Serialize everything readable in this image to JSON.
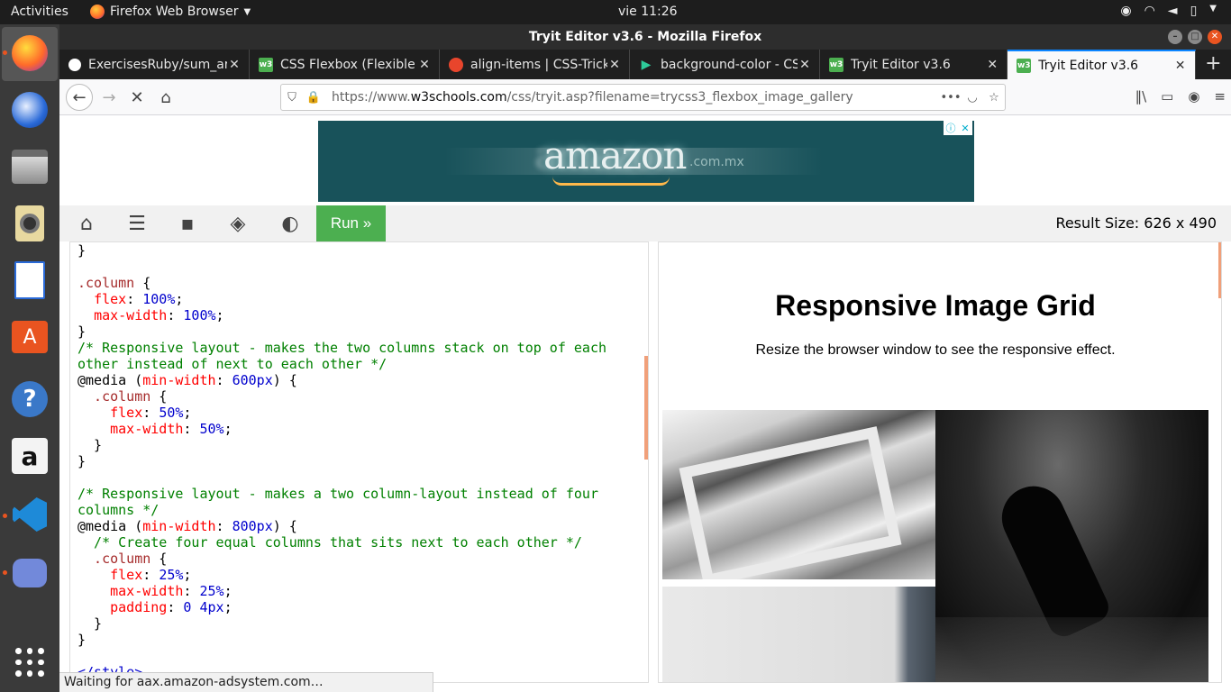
{
  "topbar": {
    "activities": "Activities",
    "app_menu": "Firefox Web Browser",
    "clock": "vie 11:26"
  },
  "window": {
    "title": "Tryit Editor v3.6 - Mozilla Firefox"
  },
  "tabs": [
    {
      "label": "ExercisesRuby/sum_ar",
      "icon": "github-icon"
    },
    {
      "label": "CSS Flexbox (Flexible B",
      "icon": "w3schools-icon"
    },
    {
      "label": "align-items | CSS-Tricks",
      "icon": "css-tricks-icon"
    },
    {
      "label": "background-color - CSS",
      "icon": "mdn-icon"
    },
    {
      "label": "Tryit Editor v3.6",
      "icon": "w3schools-icon"
    },
    {
      "label": "Tryit Editor v3.6",
      "icon": "w3schools-icon"
    }
  ],
  "navbar": {
    "url_prefix": "https://www.",
    "url_domain": "w3schools.com",
    "url_path": "/css/tryit.asp?filename=trycss3_flexbox_image_gallery"
  },
  "ad": {
    "logo": "amazon",
    "domain_suffix": ".com.mx",
    "info": "ⓘ",
    "close": "✕"
  },
  "editor_toolbar": {
    "run_label": "Run »",
    "result_size": "Result Size: 626 x 490"
  },
  "code_lines": [
    [
      {
        "t": "}",
        "c": ""
      }
    ],
    [
      {
        "t": "",
        "c": ""
      }
    ],
    [
      {
        "t": ".column",
        "c": "c-sel"
      },
      {
        "t": " {",
        "c": ""
      }
    ],
    [
      {
        "t": "  ",
        "c": ""
      },
      {
        "t": "flex",
        "c": "c-prop"
      },
      {
        "t": ": ",
        "c": ""
      },
      {
        "t": "100%",
        "c": "c-val"
      },
      {
        "t": ";",
        "c": ""
      }
    ],
    [
      {
        "t": "  ",
        "c": ""
      },
      {
        "t": "max-width",
        "c": "c-prop"
      },
      {
        "t": ": ",
        "c": ""
      },
      {
        "t": "100%",
        "c": "c-val"
      },
      {
        "t": ";",
        "c": ""
      }
    ],
    [
      {
        "t": "}",
        "c": ""
      }
    ],
    [
      {
        "t": "/* Responsive layout - makes the two columns stack on top of each",
        "c": "c-com"
      }
    ],
    [
      {
        "t": "other instead of next to each other */",
        "c": "c-com"
      }
    ],
    [
      {
        "t": "@media (",
        "c": "c-at"
      },
      {
        "t": "min-width",
        "c": "c-prop"
      },
      {
        "t": ": ",
        "c": ""
      },
      {
        "t": "600px",
        "c": "c-val"
      },
      {
        "t": ") {",
        "c": ""
      }
    ],
    [
      {
        "t": "  .column",
        "c": "c-sel"
      },
      {
        "t": " {",
        "c": ""
      }
    ],
    [
      {
        "t": "    ",
        "c": ""
      },
      {
        "t": "flex",
        "c": "c-prop"
      },
      {
        "t": ": ",
        "c": ""
      },
      {
        "t": "50%",
        "c": "c-val"
      },
      {
        "t": ";",
        "c": ""
      }
    ],
    [
      {
        "t": "    ",
        "c": ""
      },
      {
        "t": "max-width",
        "c": "c-prop"
      },
      {
        "t": ": ",
        "c": ""
      },
      {
        "t": "50%",
        "c": "c-val"
      },
      {
        "t": ";",
        "c": ""
      }
    ],
    [
      {
        "t": "  }",
        "c": ""
      }
    ],
    [
      {
        "t": "}",
        "c": ""
      }
    ],
    [
      {
        "t": "",
        "c": ""
      }
    ],
    [
      {
        "t": "/* Responsive layout - makes a two column-layout instead of four",
        "c": "c-com"
      }
    ],
    [
      {
        "t": "columns */",
        "c": "c-com"
      }
    ],
    [
      {
        "t": "@media (",
        "c": "c-at"
      },
      {
        "t": "min-width",
        "c": "c-prop"
      },
      {
        "t": ": ",
        "c": ""
      },
      {
        "t": "800px",
        "c": "c-val"
      },
      {
        "t": ") {",
        "c": ""
      }
    ],
    [
      {
        "t": "  /* Create four equal columns that sits next to each other */",
        "c": "c-com"
      }
    ],
    [
      {
        "t": "  .column",
        "c": "c-sel"
      },
      {
        "t": " {",
        "c": ""
      }
    ],
    [
      {
        "t": "    ",
        "c": ""
      },
      {
        "t": "flex",
        "c": "c-prop"
      },
      {
        "t": ": ",
        "c": ""
      },
      {
        "t": "25%",
        "c": "c-val"
      },
      {
        "t": ";",
        "c": ""
      }
    ],
    [
      {
        "t": "    ",
        "c": ""
      },
      {
        "t": "max-width",
        "c": "c-prop"
      },
      {
        "t": ": ",
        "c": ""
      },
      {
        "t": "25%",
        "c": "c-val"
      },
      {
        "t": ";",
        "c": ""
      }
    ],
    [
      {
        "t": "    ",
        "c": ""
      },
      {
        "t": "padding",
        "c": "c-prop"
      },
      {
        "t": ": ",
        "c": ""
      },
      {
        "t": "0 4px",
        "c": "c-val"
      },
      {
        "t": ";",
        "c": ""
      }
    ],
    [
      {
        "t": "  }",
        "c": ""
      }
    ],
    [
      {
        "t": "}",
        "c": ""
      }
    ],
    [
      {
        "t": "",
        "c": ""
      }
    ],
    [
      {
        "t": "</style>",
        "c": "c-val"
      }
    ]
  ],
  "result": {
    "heading": "Responsive Image Grid",
    "subtitle": "Resize the browser window to see the responsive effect."
  },
  "status": {
    "text": "Waiting for aax.amazon-adsystem.com…"
  },
  "colors": {
    "run_button": "#4caf50",
    "accent": "#e95420",
    "selected_tab_line": "#0a84ff"
  }
}
